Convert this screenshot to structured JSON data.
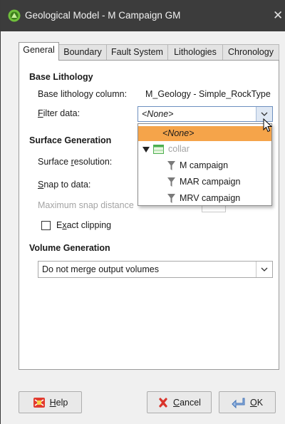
{
  "window": {
    "title": "Geological Model - M Campaign GM",
    "close": "✕"
  },
  "tabs": [
    {
      "label": "General",
      "active": true
    },
    {
      "label": "Boundary",
      "active": false
    },
    {
      "label": "Fault System",
      "active": false
    },
    {
      "label": "Lithologies",
      "active": false
    },
    {
      "label": "Chronology",
      "active": false
    }
  ],
  "base_lithology": {
    "heading": "Base Lithology",
    "column_label": "Base lithology column:",
    "column_value": "M_Geology - Simple_RockType",
    "filter_label": "Filter data:",
    "filter_value": "<None>"
  },
  "surface_generation": {
    "heading": "Surface Generation",
    "resolution_label": "Surface resolution:",
    "snap_label": "Snap to data:",
    "max_snap_label": "Maximum snap distance",
    "exact_clipping_label": "Exact clipping",
    "exact_clipping_checked": false
  },
  "volume_generation": {
    "heading": "Volume Generation",
    "merge_value": "Do not merge output volumes"
  },
  "dropdown": {
    "items": [
      {
        "label": "<None>",
        "type": "option",
        "selected": true
      },
      {
        "label": "collar",
        "type": "table",
        "disabled": true
      },
      {
        "label": "M campaign",
        "type": "filter"
      },
      {
        "label": "MAR campaign",
        "type": "filter"
      },
      {
        "label": "MRV campaign",
        "type": "filter"
      }
    ]
  },
  "buttons": {
    "help": "Help",
    "cancel": "Cancel",
    "ok": "OK"
  },
  "colors": {
    "titlebar": "#3c3c3c",
    "selection": "#f5a44a",
    "filter_icon": "#7a7a7a",
    "table_icon": "#4caf50",
    "cancel_icon": "#d9342b"
  }
}
